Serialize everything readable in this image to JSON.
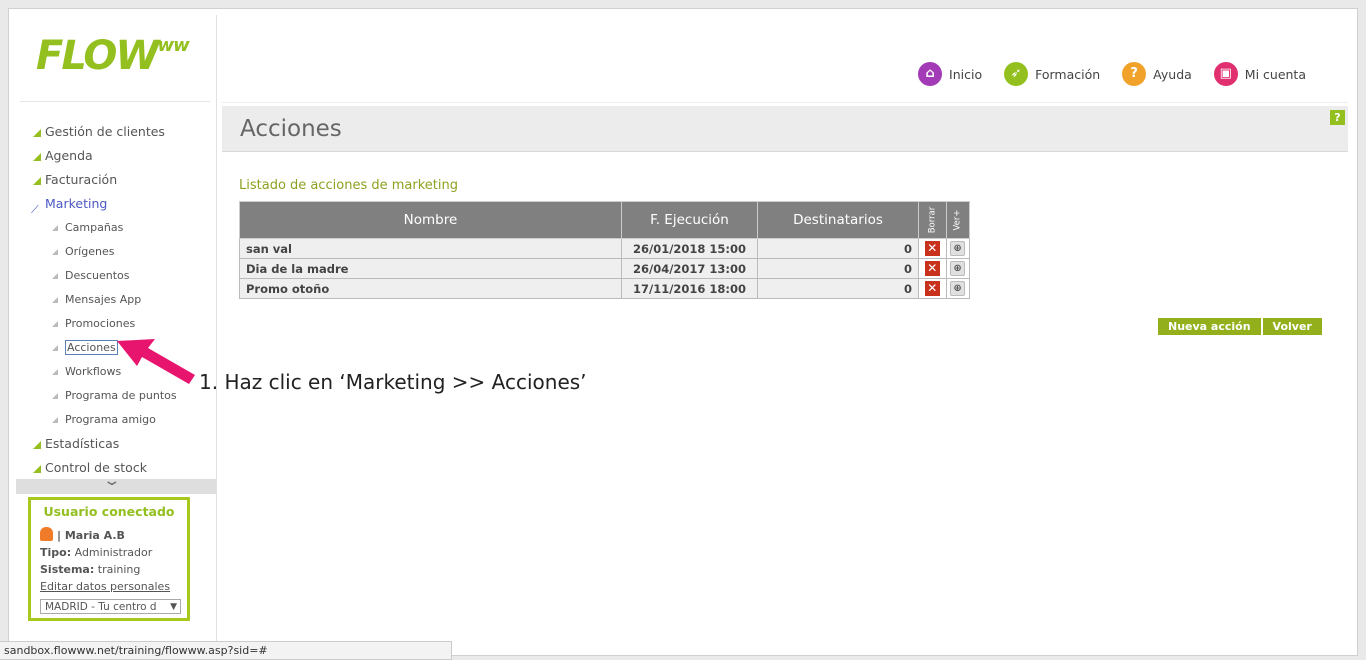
{
  "logo": {
    "main": "FLOW",
    "sup": "ww"
  },
  "nav": [
    {
      "label": "Inicio",
      "icon": "home-icon",
      "color": "#a23bb5",
      "glyph": "⌂"
    },
    {
      "label": "Formación",
      "icon": "rocket-icon",
      "color": "#93c01f",
      "glyph": "➶"
    },
    {
      "label": "Ayuda",
      "icon": "help-icon",
      "color": "#f0a22a",
      "glyph": "?"
    },
    {
      "label": "Mi cuenta",
      "icon": "briefcase-icon",
      "color": "#e0306f",
      "glyph": "▣"
    }
  ],
  "sidebar": {
    "items": [
      {
        "label": "Gestión de clientes"
      },
      {
        "label": "Agenda"
      },
      {
        "label": "Facturación"
      },
      {
        "label": "Marketing"
      },
      {
        "label": "Campañas"
      },
      {
        "label": "Orígenes"
      },
      {
        "label": "Descuentos"
      },
      {
        "label": "Mensajes App"
      },
      {
        "label": "Promociones"
      },
      {
        "label": "Acciones"
      },
      {
        "label": "Workflows"
      },
      {
        "label": "Programa de puntos"
      },
      {
        "label": "Programa amigo"
      },
      {
        "label": "Estadísticas"
      },
      {
        "label": "Control de stock"
      }
    ]
  },
  "user": {
    "title": "Usuario conectado",
    "name": "| Maria A.B",
    "tipo_label": "Tipo:",
    "tipo": "Administrador",
    "sistema_label": "Sistema:",
    "sistema": "training",
    "edit_link": "Editar datos personales",
    "center": "MADRID - Tu centro d"
  },
  "page": {
    "title": "Acciones",
    "help": "?",
    "list_title": "Listado de acciones de marketing"
  },
  "table": {
    "headers": [
      "Nombre",
      "F. Ejecución",
      "Destinatarios",
      "Borrar",
      "Ver+"
    ],
    "rows": [
      {
        "nombre": "san val",
        "fecha": "26/01/2018 15:00",
        "dest": "0"
      },
      {
        "nombre": "Dia de la madre",
        "fecha": "26/04/2017 13:00",
        "dest": "0"
      },
      {
        "nombre": "Promo otoño",
        "fecha": "17/11/2016 18:00",
        "dest": "0"
      }
    ]
  },
  "buttons": {
    "new": "Nueva acción",
    "back": "Volver"
  },
  "annotation": "1. Haz clic en ‘Marketing >> Acciones’",
  "status_url": "sandbox.flowww.net/training/flowww.asp?sid=#",
  "colors": {
    "accent": "#93c01f",
    "arrow": "#e8156e",
    "header": "#808080",
    "marketing": "#4a58c3"
  }
}
